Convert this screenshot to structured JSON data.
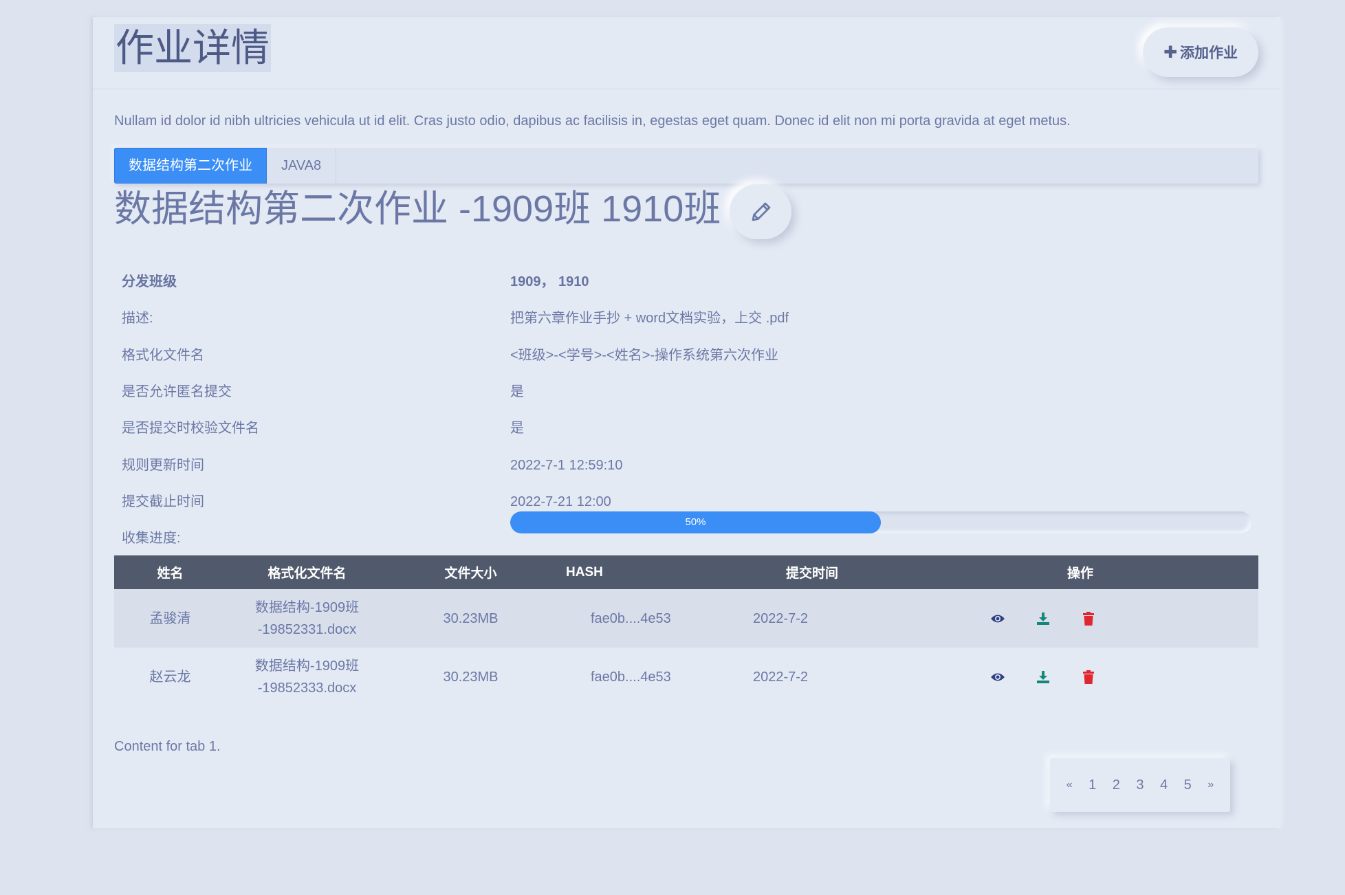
{
  "header": {
    "title": "作业详情",
    "add_button": "添加作业",
    "add_icon": "plus-icon"
  },
  "intro": "Nullam id dolor id nibh ultricies vehicula ut id elit. Cras justo odio, dapibus ac facilisis in, egestas eget quam. Donec id elit non mi porta gravida at eget metus.",
  "tabs": [
    {
      "label": "数据结构第二次作业",
      "active": true
    },
    {
      "label": "JAVA8",
      "active": false
    }
  ],
  "homework": {
    "title": "数据结构第二次作业 -1909班 1910班",
    "edit_icon": "pencil-icon",
    "info": [
      {
        "key": "分发班级",
        "value": "1909， 1910"
      },
      {
        "key": "描述:",
        "value": "把第六章作业手抄 + word文档实验，上交 .pdf"
      },
      {
        "key": "格式化文件名",
        "value": "<班级>-<学号>-<姓名>-操作系统第六次作业"
      },
      {
        "key": "是否允许匿名提交",
        "value": "是"
      },
      {
        "key": "是否提交时校验文件名",
        "value": "是"
      },
      {
        "key": "规则更新时间",
        "value": "2022-7-1 12:59:10"
      },
      {
        "key": "提交截止时间",
        "value": "2022-7-21 12:00"
      }
    ],
    "progress": {
      "label": "收集进度:",
      "text": "50%",
      "fraction": 0.5
    }
  },
  "table": {
    "columns": [
      "姓名",
      "格式化文件名",
      "文件大小",
      "HASH",
      "提交时间",
      "操作"
    ],
    "rows": [
      {
        "name": "孟骏清",
        "file_line1": "数据结构-1909班",
        "file_line2": "-19852331.docx",
        "size": "30.23MB",
        "hash": "fae0b....4e53",
        "time": "2022-7-2"
      },
      {
        "name": "赵云龙",
        "file_line1": "数据结构-1909班",
        "file_line2": "-19852333.docx",
        "size": "30.23MB",
        "hash": "fae0b....4e53",
        "time": "2022-7-2"
      }
    ],
    "icons": {
      "view": "eye-icon",
      "download": "download-icon",
      "delete": "trash-icon"
    },
    "colors": {
      "view": "#2f3f7f",
      "download": "#17867a",
      "delete": "#e0262f",
      "header_bg": "#515a6c"
    }
  },
  "tab_content": "Content for tab 1.",
  "pagination": {
    "prev": "«",
    "pages": [
      "1",
      "2",
      "3",
      "4",
      "5"
    ],
    "next": "»"
  },
  "colors": {
    "accent": "#3a8ef5",
    "background": "#e4eaf4"
  }
}
